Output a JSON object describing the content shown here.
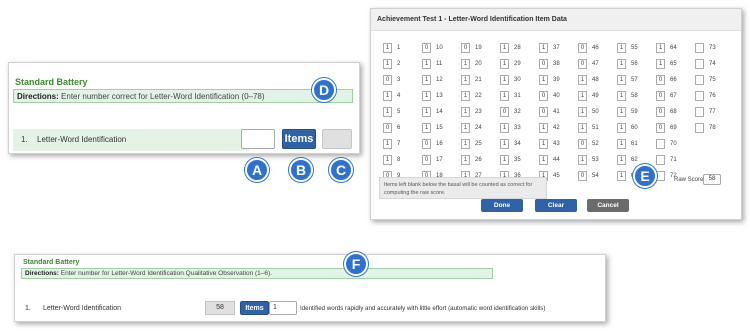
{
  "panelTop": {
    "section_title": "Standard Battery",
    "directions_label": "Directions:",
    "directions_text": "Enter number correct for Letter-Word Identification (0–78)",
    "item_number": "1.",
    "item_label": "Letter-Word Identification",
    "items_button": "Items",
    "callouts": {
      "a": "A",
      "b": "B",
      "c": "C",
      "d": "D"
    }
  },
  "dialog": {
    "title": "Achievement Test 1 - Letter-Word Identification Item Data",
    "columns": [
      {
        "values": [
          "1",
          "1",
          "0",
          "1",
          "1",
          "0",
          "1",
          "1",
          "0"
        ],
        "items": [
          "1",
          "2",
          "3",
          "4",
          "5",
          "6",
          "7",
          "8",
          "9"
        ]
      },
      {
        "values": [
          "0",
          "1",
          "1",
          "1",
          "1",
          "1",
          "0",
          "0",
          "0"
        ],
        "items": [
          "10",
          "11",
          "12",
          "13",
          "14",
          "15",
          "16",
          "17",
          "18"
        ]
      },
      {
        "values": [
          "0",
          "1",
          "1",
          "1",
          "1",
          "1",
          "1",
          "1",
          "1"
        ],
        "items": [
          "19",
          "20",
          "21",
          "22",
          "23",
          "24",
          "25",
          "26",
          "27"
        ]
      },
      {
        "values": [
          "1",
          "1",
          "1",
          "1",
          "0",
          "1",
          "1",
          "1",
          "1"
        ],
        "items": [
          "28",
          "29",
          "30",
          "31",
          "32",
          "33",
          "34",
          "35",
          "36"
        ]
      },
      {
        "values": [
          "1",
          "0",
          "1",
          "0",
          "0",
          "1",
          "1",
          "1",
          "1"
        ],
        "items": [
          "37",
          "38",
          "39",
          "40",
          "41",
          "42",
          "43",
          "44",
          "45"
        ]
      },
      {
        "values": [
          "0",
          "0",
          "1",
          "1",
          "1",
          "1",
          "0",
          "1",
          "0"
        ],
        "items": [
          "46",
          "47",
          "48",
          "49",
          "50",
          "51",
          "52",
          "53",
          "54"
        ]
      },
      {
        "values": [
          "1",
          "1",
          "1",
          "1",
          "1",
          "1",
          "1",
          "1",
          "1"
        ],
        "items": [
          "55",
          "56",
          "57",
          "58",
          "59",
          "60",
          "61",
          "62",
          "63"
        ]
      },
      {
        "values": [
          "1",
          "1",
          "0",
          "0",
          "0",
          "0",
          "",
          "",
          ""
        ],
        "items": [
          "64",
          "65",
          "66",
          "67",
          "68",
          "69",
          "70",
          "71",
          "72"
        ]
      },
      {
        "values": [
          "",
          "",
          "",
          "",
          "",
          "",
          "",
          "",
          ""
        ],
        "items": [
          "73",
          "74",
          "75",
          "76",
          "77",
          "78",
          "",
          "",
          ""
        ]
      }
    ],
    "note": "Items left blank below the basal will be counted as correct for computing the raw score.",
    "raw_score_label": "Raw Score",
    "raw_score_value": "58",
    "done_label": "Done",
    "clear_label": "Clear",
    "cancel_label": "Cancel",
    "callout_e": "E"
  },
  "panelBottom": {
    "section_title": "Standard Battery",
    "directions_label": "Directions:",
    "directions_text": "Enter number for Letter-Word Identification Qualitative Observation (1–6).",
    "item_number": "1.",
    "item_label": "Letter-Word Identification",
    "score_value": "58",
    "items_button": "Items",
    "qual_value": "1",
    "qual_text": "Identified words rapidly and accurately with little effort (automatic word identification skills)",
    "callout_f": "F"
  },
  "colors": {
    "accent_green": "#3c8a2e",
    "button_blue": "#2f63a8",
    "callout_blue": "#2d72d2",
    "cancel_gray": "#6b6b6b"
  }
}
